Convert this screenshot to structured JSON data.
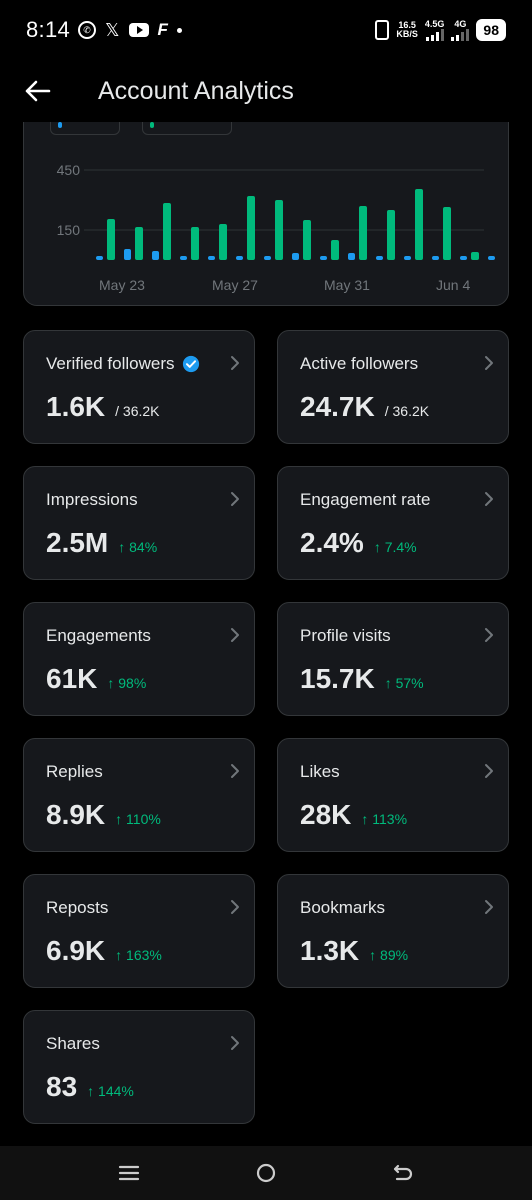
{
  "status_bar": {
    "time": "8:14",
    "net_speed_value": "16.5",
    "net_speed_unit": "KB/S",
    "net_type_1": "4.5G",
    "net_type_2": "4G",
    "battery": "98",
    "icons": [
      "whatsapp-icon",
      "x-icon",
      "youtube-icon",
      "f-app-icon",
      "dot-icon"
    ]
  },
  "header": {
    "title": "Account Analytics"
  },
  "colors": {
    "blue": "#1d9bf0",
    "green": "#00ba7c",
    "card_bg": "#16181c",
    "border": "#333639"
  },
  "chart_data": {
    "type": "bar",
    "x_tick_labels": [
      "May 23",
      "May 27",
      "May 31",
      "Jun 4"
    ],
    "y_tick_labels": [
      "450",
      "150"
    ],
    "ylim": [
      0,
      600
    ],
    "grid": true,
    "series": [
      {
        "color": "#1d9bf0",
        "values": [
          20,
          55,
          45,
          20,
          20,
          20,
          20,
          35,
          20,
          35,
          20,
          20,
          20,
          20,
          20
        ]
      },
      {
        "color": "#00ba7c",
        "values": [
          205,
          165,
          285,
          165,
          180,
          320,
          300,
          200,
          100,
          270,
          250,
          355,
          265,
          40,
          0
        ]
      }
    ]
  },
  "stats": [
    {
      "label": "Verified followers",
      "value": "1.6K",
      "sub": "/ 36.2K",
      "delta": "",
      "verified": true
    },
    {
      "label": "Active followers",
      "value": "24.7K",
      "sub": "/ 36.2K",
      "delta": "",
      "verified": false
    },
    {
      "label": "Impressions",
      "value": "2.5M",
      "sub": "",
      "delta": "↑ 84%",
      "verified": false
    },
    {
      "label": "Engagement rate",
      "value": "2.4%",
      "sub": "",
      "delta": "↑ 7.4%",
      "verified": false
    },
    {
      "label": "Engagements",
      "value": "61K",
      "sub": "",
      "delta": "↑ 98%",
      "verified": false
    },
    {
      "label": "Profile visits",
      "value": "15.7K",
      "sub": "",
      "delta": "↑ 57%",
      "verified": false
    },
    {
      "label": "Replies",
      "value": "8.9K",
      "sub": "",
      "delta": "↑ 110%",
      "verified": false
    },
    {
      "label": "Likes",
      "value": "28K",
      "sub": "",
      "delta": "↑ 113%",
      "verified": false
    },
    {
      "label": "Reposts",
      "value": "6.9K",
      "sub": "",
      "delta": "↑ 163%",
      "verified": false
    },
    {
      "label": "Bookmarks",
      "value": "1.3K",
      "sub": "",
      "delta": "↑ 89%",
      "verified": false
    },
    {
      "label": "Shares",
      "value": "83",
      "sub": "",
      "delta": "↑ 144%",
      "verified": false
    }
  ],
  "nav_bar": {
    "buttons": [
      "recent-apps-icon",
      "home-icon",
      "back-icon"
    ]
  }
}
